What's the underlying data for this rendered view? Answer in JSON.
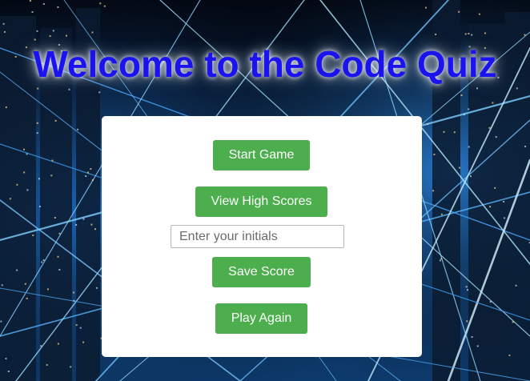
{
  "page": {
    "title": "Welcome to the Code Quiz"
  },
  "quiz": {
    "start_label": "Start Game",
    "view_scores_label": "View High Scores",
    "initials_placeholder": "Enter your initials",
    "initials_value": "",
    "save_label": "Save Score",
    "play_again_label": "Play Again"
  },
  "colors": {
    "title": "#1a13f0",
    "button": "#4cae4c",
    "card": "#ffffff"
  },
  "background": {
    "description_icon": "network-lights-background"
  }
}
